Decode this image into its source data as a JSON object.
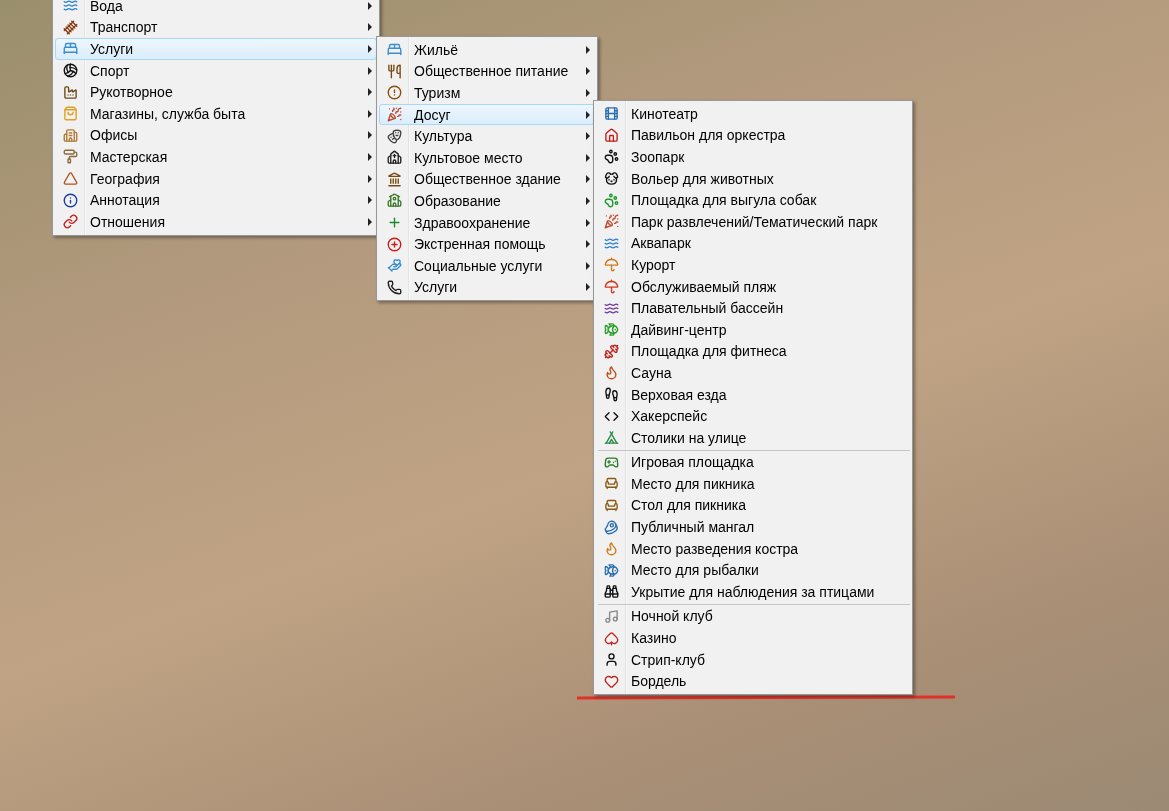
{
  "menus": [
    {
      "items": [
        {
          "label": "Вода",
          "selected": false,
          "submenu": true
        },
        {
          "label": "Транспорт",
          "selected": false,
          "submenu": true
        },
        {
          "label": "Услуги",
          "selected": true,
          "submenu": true
        },
        {
          "label": "Спорт",
          "selected": false,
          "submenu": true
        },
        {
          "label": "Рукотворное",
          "selected": false,
          "submenu": true
        },
        {
          "label": "Магазины, служба быта",
          "selected": false,
          "submenu": true
        },
        {
          "label": "Офисы",
          "selected": false,
          "submenu": true
        },
        {
          "label": "Мастерская",
          "selected": false,
          "submenu": true
        },
        {
          "label": "География",
          "selected": false,
          "submenu": true
        },
        {
          "label": "Аннотация",
          "selected": false,
          "submenu": true
        },
        {
          "label": "Отношения",
          "selected": false,
          "submenu": true
        }
      ]
    },
    {
      "items": [
        {
          "label": "Жильё",
          "selected": false,
          "submenu": true
        },
        {
          "label": "Общественное питание",
          "selected": false,
          "submenu": true
        },
        {
          "label": "Туризм",
          "selected": false,
          "submenu": true
        },
        {
          "label": "Досуг",
          "selected": true,
          "submenu": true
        },
        {
          "label": "Культура",
          "selected": false,
          "submenu": true
        },
        {
          "label": "Культовое место",
          "selected": false,
          "submenu": true
        },
        {
          "label": "Общественное здание",
          "selected": false,
          "submenu": true
        },
        {
          "label": "Образование",
          "selected": false,
          "submenu": true
        },
        {
          "label": "Здравоохранение",
          "selected": false,
          "submenu": true
        },
        {
          "label": "Экстренная помощь",
          "selected": false,
          "submenu": true
        },
        {
          "label": "Социальные услуги",
          "selected": false,
          "submenu": true
        },
        {
          "label": "Услуги",
          "selected": false,
          "submenu": true
        }
      ]
    },
    {
      "items": [
        {
          "label": "Кинотеатр",
          "selected": false,
          "submenu": false,
          "separator_before": false
        },
        {
          "label": "Павильон для оркестра",
          "selected": false,
          "submenu": false,
          "separator_before": false
        },
        {
          "label": "Зоопарк",
          "selected": false,
          "submenu": false,
          "separator_before": false
        },
        {
          "label": "Вольер для животных",
          "selected": false,
          "submenu": false,
          "separator_before": false
        },
        {
          "label": "Площадка для выгула собак",
          "selected": false,
          "submenu": false,
          "separator_before": false
        },
        {
          "label": "Парк развлечений/Тематический парк",
          "selected": false,
          "submenu": false,
          "separator_before": false
        },
        {
          "label": "Аквапарк",
          "selected": false,
          "submenu": false,
          "separator_before": false
        },
        {
          "label": "Курорт",
          "selected": false,
          "submenu": false,
          "separator_before": false
        },
        {
          "label": "Обслуживаемый пляж",
          "selected": false,
          "submenu": false,
          "separator_before": false
        },
        {
          "label": "Плавательный бассейн",
          "selected": false,
          "submenu": false,
          "separator_before": false
        },
        {
          "label": "Дайвинг-центр",
          "selected": false,
          "submenu": false,
          "separator_before": false
        },
        {
          "label": "Площадка для фитнеса",
          "selected": false,
          "submenu": false,
          "separator_before": false
        },
        {
          "label": "Сауна",
          "selected": false,
          "submenu": false,
          "separator_before": false
        },
        {
          "label": "Верховая езда",
          "selected": false,
          "submenu": false,
          "separator_before": false
        },
        {
          "label": "Хакерспейс",
          "selected": false,
          "submenu": false,
          "separator_before": false
        },
        {
          "label": "Столики на улице",
          "selected": false,
          "submenu": false,
          "separator_before": false
        },
        {
          "label": "Игровая площадка",
          "selected": false,
          "submenu": false,
          "separator_before": true
        },
        {
          "label": "Место для пикника",
          "selected": false,
          "submenu": false,
          "separator_before": false
        },
        {
          "label": "Стол для пикника",
          "selected": false,
          "submenu": false,
          "separator_before": false
        },
        {
          "label": "Публичный мангал",
          "selected": false,
          "submenu": false,
          "separator_before": false
        },
        {
          "label": "Место разведения костра",
          "selected": false,
          "submenu": false,
          "separator_before": false
        },
        {
          "label": "Место для рыбалки",
          "selected": false,
          "submenu": false,
          "separator_before": false
        },
        {
          "label": "Укрытие для наблюдения за птицами",
          "selected": false,
          "submenu": false,
          "separator_before": false
        },
        {
          "label": "Ночной клуб",
          "selected": false,
          "submenu": false,
          "separator_before": true
        },
        {
          "label": "Казино",
          "selected": false,
          "submenu": false,
          "separator_before": false
        },
        {
          "label": "Стрип-клуб",
          "selected": false,
          "submenu": false,
          "separator_before": false
        },
        {
          "label": "Бордель",
          "selected": false,
          "submenu": false,
          "separator_before": false
        }
      ]
    }
  ]
}
